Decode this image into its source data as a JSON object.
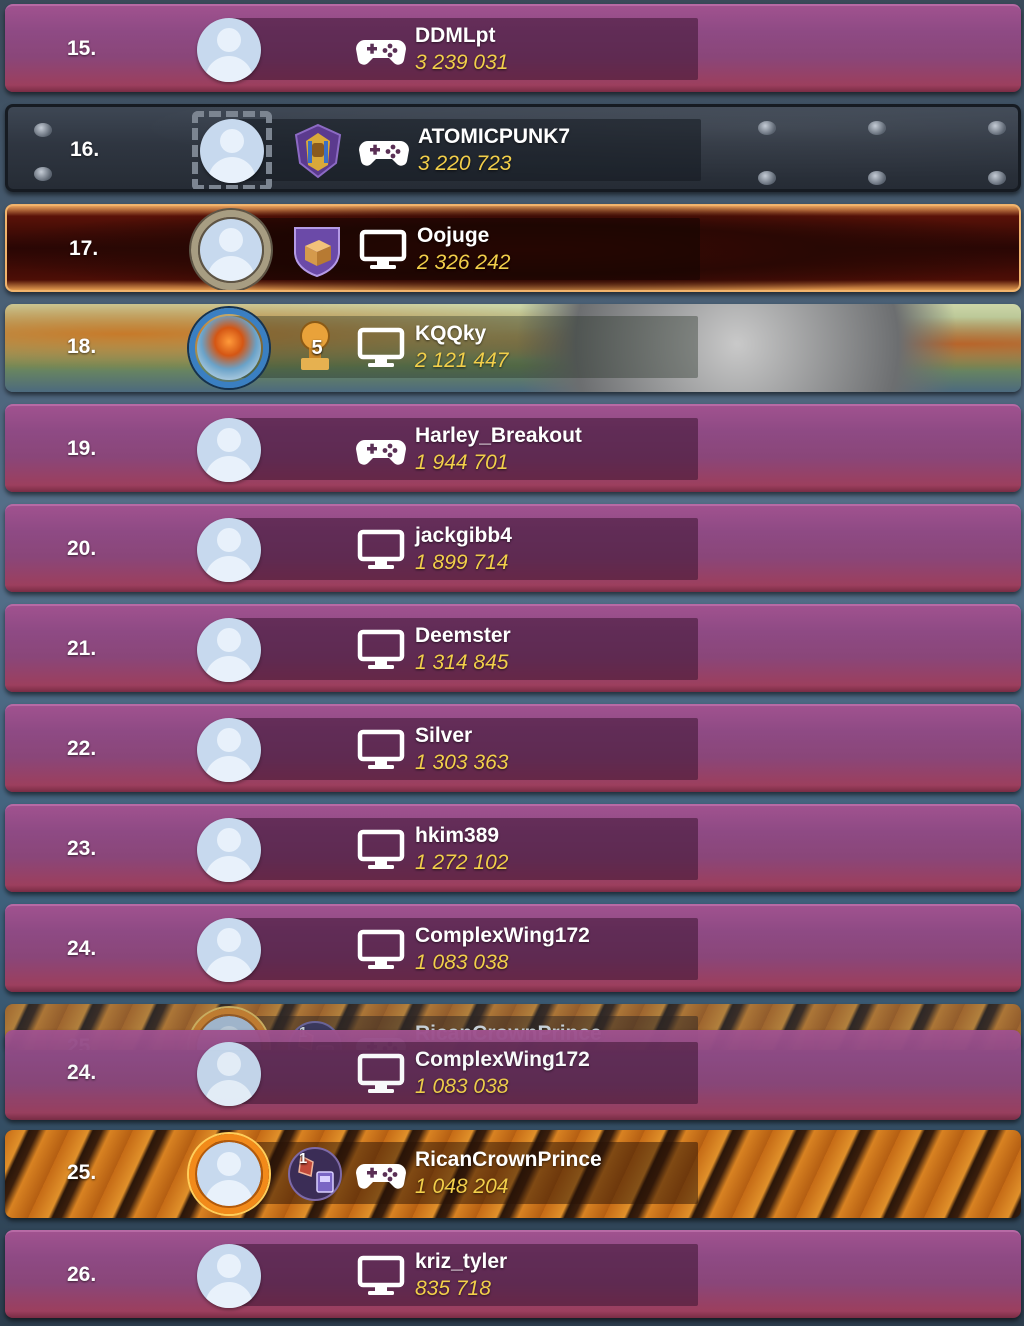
{
  "leaderboard": {
    "rows": [
      {
        "rank": "15.",
        "name": "DDMLpt",
        "score": "3 239 031",
        "platform": "gamepad",
        "theme": "default"
      },
      {
        "rank": "16.",
        "name": "ATOMICPUNK7",
        "score": "3 220 723",
        "platform": "gamepad",
        "theme": "metal",
        "badge": "pharaoh-emblem"
      },
      {
        "rank": "17.",
        "name": "Oojuge",
        "score": "2 326 242",
        "platform": "desktop",
        "theme": "fire",
        "badge": "crate-shield-emblem"
      },
      {
        "rank": "18.",
        "name": "KQQky",
        "score": "2 121 447",
        "platform": "desktop",
        "theme": "autumn",
        "badge": "trophy-emblem",
        "badge_number": "5"
      },
      {
        "rank": "19.",
        "name": "Harley_Breakout",
        "score": "1 944 701",
        "platform": "gamepad",
        "theme": "default"
      },
      {
        "rank": "20.",
        "name": "jackgibb4",
        "score": "1 899 714",
        "platform": "desktop",
        "theme": "default"
      },
      {
        "rank": "21.",
        "name": "Deemster",
        "score": "1 314 845",
        "platform": "desktop",
        "theme": "default"
      },
      {
        "rank": "22.",
        "name": "Silver",
        "score": "1 303 363",
        "platform": "desktop",
        "theme": "default"
      },
      {
        "rank": "23.",
        "name": "hkim389",
        "score": "1 272 102",
        "platform": "desktop",
        "theme": "default"
      },
      {
        "rank": "24.",
        "name": "ComplexWing172",
        "score": "1 083 038",
        "platform": "desktop",
        "theme": "default"
      }
    ],
    "ghost_row": {
      "rank": "25.",
      "name": "RicanCrownPrince",
      "badge_number": "1"
    },
    "pinned_rows": [
      {
        "rank": "24.",
        "name": "ComplexWing172",
        "score": "1 083 038",
        "platform": "desktop",
        "theme": "default"
      },
      {
        "rank": "25.",
        "name": "RicanCrownPrince",
        "score": "1 048 204",
        "platform": "gamepad",
        "theme": "tiger",
        "badge": "pinball-emblem",
        "badge_number": "1"
      },
      {
        "rank": "26.",
        "name": "kriz_tyler",
        "score": "835 718",
        "platform": "desktop",
        "theme": "default"
      }
    ]
  },
  "colors": {
    "row_purple": "#8e4a84",
    "name_white": "#ffffff",
    "score_gold": "#f2cf4a"
  }
}
